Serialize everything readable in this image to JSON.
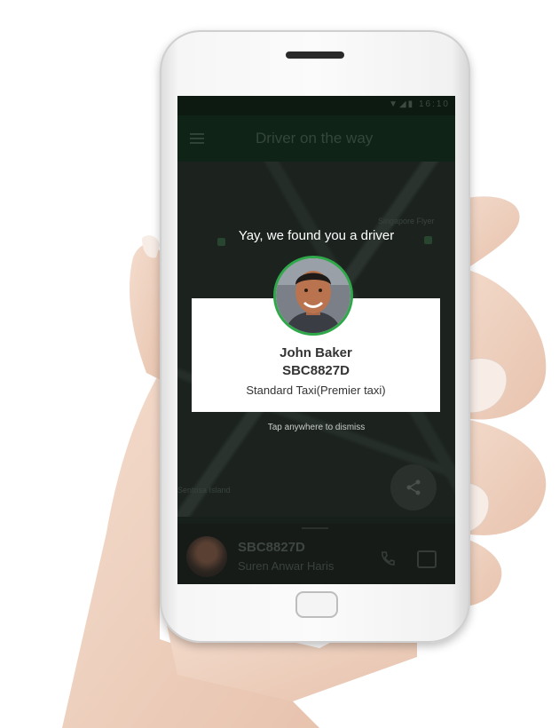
{
  "status_bar": {
    "time": "16:10"
  },
  "app_bar": {
    "title": "Driver on the way"
  },
  "map": {
    "label_top": "Singapore Flyer",
    "label_left": "Sentosa Island"
  },
  "dialog": {
    "heading": "Yay, we found you a driver",
    "driver_name": "John Baker",
    "plate": "SBC8827D",
    "vehicle": "Standard Taxi(Premier taxi)",
    "dismiss_hint": "Tap anywhere to dismiss"
  },
  "bottom_card": {
    "plate": "SBC8827D",
    "driver_name": "Suren Anwar Haris"
  },
  "colors": {
    "accent": "#2fa84a",
    "overlay": "#17201b"
  }
}
